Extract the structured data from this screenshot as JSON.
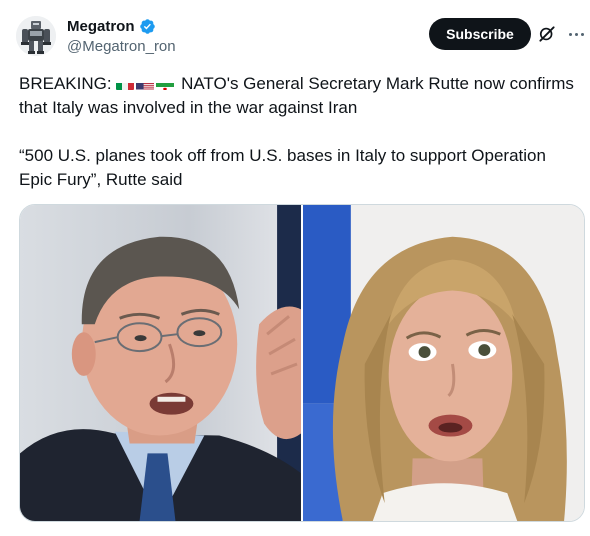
{
  "author": {
    "display_name": "Megatron",
    "handle": "@Megatron_ron",
    "verified": true,
    "avatar_icon": "robot-avatar"
  },
  "actions": {
    "subscribe_label": "Subscribe",
    "grok_icon": "grok-icon",
    "more_icon": "more-options-icon"
  },
  "tweet": {
    "line1_prefix": "BREAKING:",
    "line1_suffix": "NATO's General Secretary Mark Rutte now confirms",
    "line2": "that Italy was involved in the war against Iran",
    "quote_line1": "“500 U.S. planes took off from U.S. bases in Italy to support Operation",
    "quote_line2": "Epic Fury”, Rutte said",
    "flags": [
      "italy-flag",
      "usa-flag",
      "iran-flag"
    ]
  },
  "media": {
    "photos": [
      "man-speaking-photo",
      "woman-surprised-photo"
    ]
  },
  "colors": {
    "text": "#0f1419",
    "secondary": "#536471",
    "verified": "#1d9bf0",
    "button_bg": "#0f1419",
    "border": "#cfd9de"
  }
}
